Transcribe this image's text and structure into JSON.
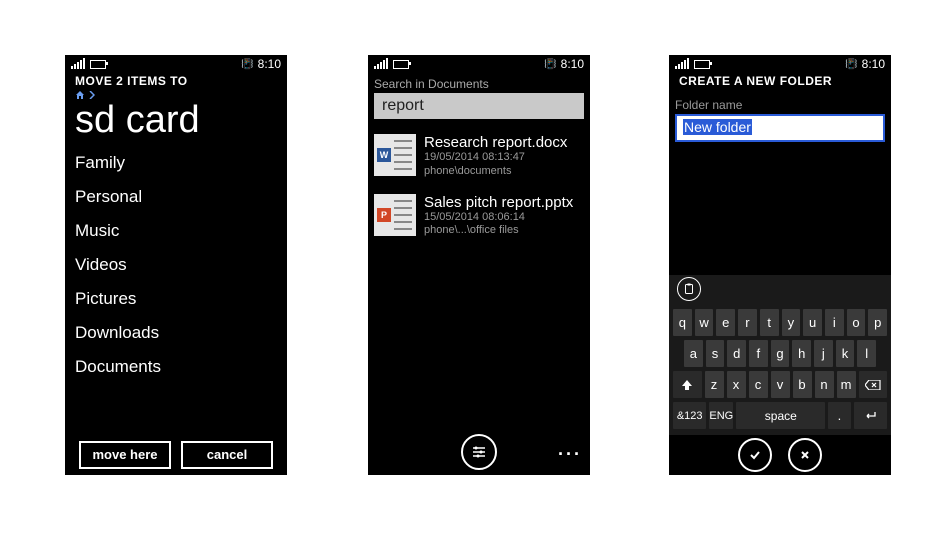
{
  "status": {
    "time": "8:10",
    "vib": "📳"
  },
  "screen1": {
    "title": "MOVE 2 ITEMS TO",
    "location": "sd card",
    "folders": [
      "Family",
      "Personal",
      "Music",
      "Videos",
      "Pictures",
      "Downloads",
      "Documents"
    ],
    "buttons": {
      "move": "move here",
      "cancel": "cancel"
    }
  },
  "screen2": {
    "search_label": "Search in Documents",
    "query": "report",
    "results": [
      {
        "name": "Research report.docx",
        "date": "19/05/2014 08:13:47",
        "path": "phone\\documents",
        "kind": "word",
        "letter": "W"
      },
      {
        "name": "Sales pitch report.pptx",
        "date": "15/05/2014 08:06:14",
        "path": "phone\\...\\office files",
        "kind": "ppt",
        "letter": "P"
      }
    ]
  },
  "screen3": {
    "title": "CREATE A NEW FOLDER",
    "field_label": "Folder name",
    "field_value": "New folder",
    "keyboard": {
      "row1": [
        "q",
        "w",
        "e",
        "r",
        "t",
        "y",
        "u",
        "i",
        "o",
        "p"
      ],
      "row2": [
        "a",
        "s",
        "d",
        "f",
        "g",
        "h",
        "j",
        "k",
        "l"
      ],
      "row3_mid": [
        "z",
        "x",
        "c",
        "v",
        "b",
        "n",
        "m"
      ],
      "fn_numsym": "&123",
      "fn_lang": "ENG",
      "space": "space",
      "period": "."
    }
  }
}
